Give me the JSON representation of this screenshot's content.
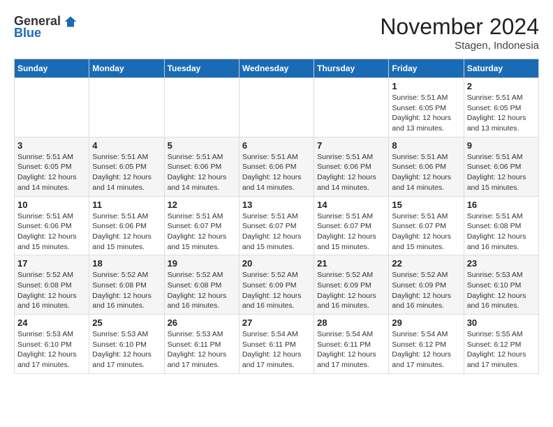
{
  "logo": {
    "general": "General",
    "blue": "Blue"
  },
  "title": "November 2024",
  "location": "Stagen, Indonesia",
  "weekdays": [
    "Sunday",
    "Monday",
    "Tuesday",
    "Wednesday",
    "Thursday",
    "Friday",
    "Saturday"
  ],
  "weeks": [
    [
      {
        "day": "",
        "info": ""
      },
      {
        "day": "",
        "info": ""
      },
      {
        "day": "",
        "info": ""
      },
      {
        "day": "",
        "info": ""
      },
      {
        "day": "",
        "info": ""
      },
      {
        "day": "1",
        "info": "Sunrise: 5:51 AM\nSunset: 6:05 PM\nDaylight: 12 hours\nand 13 minutes."
      },
      {
        "day": "2",
        "info": "Sunrise: 5:51 AM\nSunset: 6:05 PM\nDaylight: 12 hours\nand 13 minutes."
      }
    ],
    [
      {
        "day": "3",
        "info": "Sunrise: 5:51 AM\nSunset: 6:05 PM\nDaylight: 12 hours\nand 14 minutes."
      },
      {
        "day": "4",
        "info": "Sunrise: 5:51 AM\nSunset: 6:05 PM\nDaylight: 12 hours\nand 14 minutes."
      },
      {
        "day": "5",
        "info": "Sunrise: 5:51 AM\nSunset: 6:06 PM\nDaylight: 12 hours\nand 14 minutes."
      },
      {
        "day": "6",
        "info": "Sunrise: 5:51 AM\nSunset: 6:06 PM\nDaylight: 12 hours\nand 14 minutes."
      },
      {
        "day": "7",
        "info": "Sunrise: 5:51 AM\nSunset: 6:06 PM\nDaylight: 12 hours\nand 14 minutes."
      },
      {
        "day": "8",
        "info": "Sunrise: 5:51 AM\nSunset: 6:06 PM\nDaylight: 12 hours\nand 14 minutes."
      },
      {
        "day": "9",
        "info": "Sunrise: 5:51 AM\nSunset: 6:06 PM\nDaylight: 12 hours\nand 15 minutes."
      }
    ],
    [
      {
        "day": "10",
        "info": "Sunrise: 5:51 AM\nSunset: 6:06 PM\nDaylight: 12 hours\nand 15 minutes."
      },
      {
        "day": "11",
        "info": "Sunrise: 5:51 AM\nSunset: 6:06 PM\nDaylight: 12 hours\nand 15 minutes."
      },
      {
        "day": "12",
        "info": "Sunrise: 5:51 AM\nSunset: 6:07 PM\nDaylight: 12 hours\nand 15 minutes."
      },
      {
        "day": "13",
        "info": "Sunrise: 5:51 AM\nSunset: 6:07 PM\nDaylight: 12 hours\nand 15 minutes."
      },
      {
        "day": "14",
        "info": "Sunrise: 5:51 AM\nSunset: 6:07 PM\nDaylight: 12 hours\nand 15 minutes."
      },
      {
        "day": "15",
        "info": "Sunrise: 5:51 AM\nSunset: 6:07 PM\nDaylight: 12 hours\nand 15 minutes."
      },
      {
        "day": "16",
        "info": "Sunrise: 5:51 AM\nSunset: 6:08 PM\nDaylight: 12 hours\nand 16 minutes."
      }
    ],
    [
      {
        "day": "17",
        "info": "Sunrise: 5:52 AM\nSunset: 6:08 PM\nDaylight: 12 hours\nand 16 minutes."
      },
      {
        "day": "18",
        "info": "Sunrise: 5:52 AM\nSunset: 6:08 PM\nDaylight: 12 hours\nand 16 minutes."
      },
      {
        "day": "19",
        "info": "Sunrise: 5:52 AM\nSunset: 6:08 PM\nDaylight: 12 hours\nand 16 minutes."
      },
      {
        "day": "20",
        "info": "Sunrise: 5:52 AM\nSunset: 6:09 PM\nDaylight: 12 hours\nand 16 minutes."
      },
      {
        "day": "21",
        "info": "Sunrise: 5:52 AM\nSunset: 6:09 PM\nDaylight: 12 hours\nand 16 minutes."
      },
      {
        "day": "22",
        "info": "Sunrise: 5:52 AM\nSunset: 6:09 PM\nDaylight: 12 hours\nand 16 minutes."
      },
      {
        "day": "23",
        "info": "Sunrise: 5:53 AM\nSunset: 6:10 PM\nDaylight: 12 hours\nand 16 minutes."
      }
    ],
    [
      {
        "day": "24",
        "info": "Sunrise: 5:53 AM\nSunset: 6:10 PM\nDaylight: 12 hours\nand 17 minutes."
      },
      {
        "day": "25",
        "info": "Sunrise: 5:53 AM\nSunset: 6:10 PM\nDaylight: 12 hours\nand 17 minutes."
      },
      {
        "day": "26",
        "info": "Sunrise: 5:53 AM\nSunset: 6:11 PM\nDaylight: 12 hours\nand 17 minutes."
      },
      {
        "day": "27",
        "info": "Sunrise: 5:54 AM\nSunset: 6:11 PM\nDaylight: 12 hours\nand 17 minutes."
      },
      {
        "day": "28",
        "info": "Sunrise: 5:54 AM\nSunset: 6:11 PM\nDaylight: 12 hours\nand 17 minutes."
      },
      {
        "day": "29",
        "info": "Sunrise: 5:54 AM\nSunset: 6:12 PM\nDaylight: 12 hours\nand 17 minutes."
      },
      {
        "day": "30",
        "info": "Sunrise: 5:55 AM\nSunset: 6:12 PM\nDaylight: 12 hours\nand 17 minutes."
      }
    ]
  ]
}
